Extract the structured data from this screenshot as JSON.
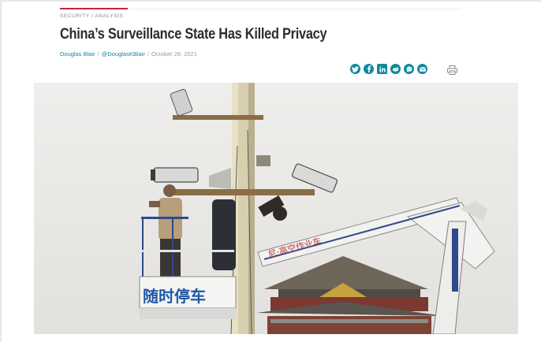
{
  "article": {
    "kicker": "SECURITY / ANALYSIS",
    "title": "China’s Surveillance State Has Killed Privacy",
    "author": "Douglas Blair",
    "separator": "/",
    "handle": "@DouglasKBlair",
    "date": "October 28, 2021"
  },
  "share": {
    "icons": [
      "twitter-icon",
      "facebook-icon",
      "linkedin-icon",
      "reddit-icon",
      "message-icon",
      "email-icon",
      "print-icon"
    ]
  },
  "photo": {
    "sign_text": "随时停车",
    "boom_text": "尼·高空作业车"
  },
  "colors": {
    "accent": "#c8243a",
    "link": "#1a7fa8",
    "share": "#0f8a9e"
  }
}
